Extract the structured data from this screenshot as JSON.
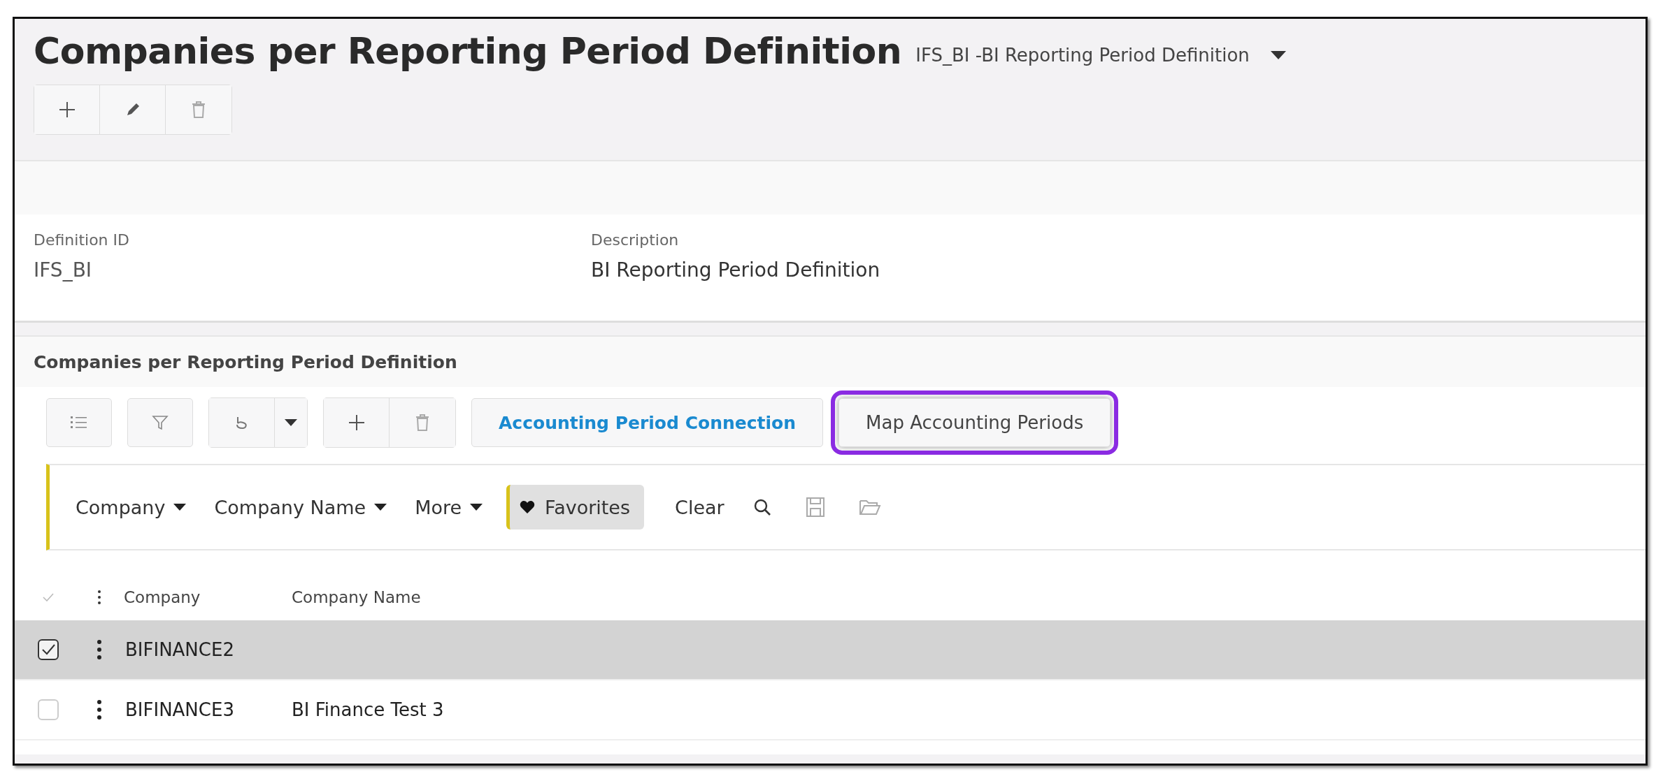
{
  "page": {
    "title": "Companies per Reporting Period Definition",
    "record_selector": "IFS_BI -BI Reporting Period Definition"
  },
  "header_toolbar": [
    {
      "kind": "add"
    },
    {
      "kind": "edit"
    },
    {
      "kind": "delete"
    }
  ],
  "header_card": {
    "fields": [
      {
        "label": "Definition ID",
        "value": "IFS_BI"
      },
      {
        "label": "Description",
        "value": "BI Reporting Period Definition"
      }
    ]
  },
  "list_panel": {
    "title": "Companies per Reporting Period Definition",
    "toolbar": {
      "commands": [
        {
          "label": "Accounting Period Connection",
          "kind": "link",
          "highlighted": false
        },
        {
          "label": "Map Accounting Periods",
          "kind": "plain",
          "highlighted": true
        }
      ]
    },
    "filter_bar": {
      "filters": [
        "Company",
        "Company Name",
        "More"
      ],
      "favorites": "Favorites",
      "clear": "Clear"
    },
    "table": {
      "columns": [
        "Company",
        "Company Name"
      ],
      "rows": [
        {
          "selected": true,
          "cells": [
            "BIFINANCE2",
            ""
          ]
        },
        {
          "selected": false,
          "cells": [
            "BIFINANCE3",
            "BI Finance Test 3"
          ]
        }
      ]
    }
  }
}
